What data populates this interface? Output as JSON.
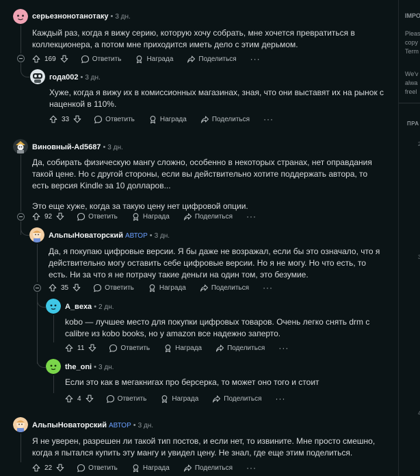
{
  "actions": {
    "reply": "Ответить",
    "award": "Награда",
    "share": "Поделиться",
    "more": "···"
  },
  "sidebar": {
    "lines": [
      "IMPO",
      "Pleas",
      "copy",
      "Term",
      "We'v",
      "alwa",
      "freel"
    ],
    "heading": "ПРА",
    "marks": [
      "2",
      "3",
      "4"
    ]
  },
  "comments": [
    {
      "author": "серьезнонотанотаку",
      "op": "",
      "age": "3 дн.",
      "votes": "169",
      "paragraphs": [
        "Каждый раз, когда я вижу серию, которую хочу собрать, мне хочется превратиться в коллекционера, а потом мне приходится иметь дело с этим дерьмом."
      ]
    },
    {
      "author": "года002",
      "op": "",
      "age": "3 дн.",
      "votes": "33",
      "paragraphs": [
        "Хуже, когда я вижу их в комиссионных магазинах, зная, что они выставят их на рынок с наценкой в 110%."
      ]
    },
    {
      "author": "Виновный-Ad5687",
      "op": "",
      "age": "3 дн.",
      "votes": "92",
      "paragraphs": [
        "Да, собирать физическую мангу сложно, особенно в некоторых странах, нет оправдания такой цене. Но с другой стороны, если вы действительно хотите поддержать автора, то есть версия Kindle за 10 долларов...",
        "Это еще хуже, когда за такую цену нет цифровой опции."
      ]
    },
    {
      "author": "АльпыНоваторский",
      "op": "АВТОР",
      "age": "3 дн.",
      "votes": "35",
      "paragraphs": [
        "Да, я покупаю цифровые версии. Я бы даже не возражал, если бы это означало, что я действительно могу оставить себе цифровые версии. Но я не могу. Но что есть, то есть. Ни за что я не потрачу такие деньги на один том, это безумие."
      ]
    },
    {
      "author": "A_вexa",
      "op": "",
      "age": "2 дн.",
      "votes": "11",
      "paragraphs": [
        "kobo — лучшее место для покупки цифровых товаров. Очень легко снять drm с calibre из kobo books, но у amazon все надежно заперто."
      ]
    },
    {
      "author": "the_oni",
      "op": "",
      "age": "3 дн.",
      "votes": "4",
      "paragraphs": [
        "Если это как в мегакнигах про берсерка, то может оно того и стоит"
      ]
    },
    {
      "author": "АльпыНоваторский",
      "op": "АВТОР",
      "age": "3 дн.",
      "votes": "22",
      "paragraphs": [
        "Я не уверен, разрешен ли такой тип постов, и если нет, то извините. Мне просто смешно, когда я пытался купить эту мангу и увидел цену. Не знал, где еще этим поделиться."
      ]
    }
  ],
  "colors": {
    "background": "#0b1416",
    "op_badge": "#6b9fff",
    "thread_line": "#343b3e"
  }
}
